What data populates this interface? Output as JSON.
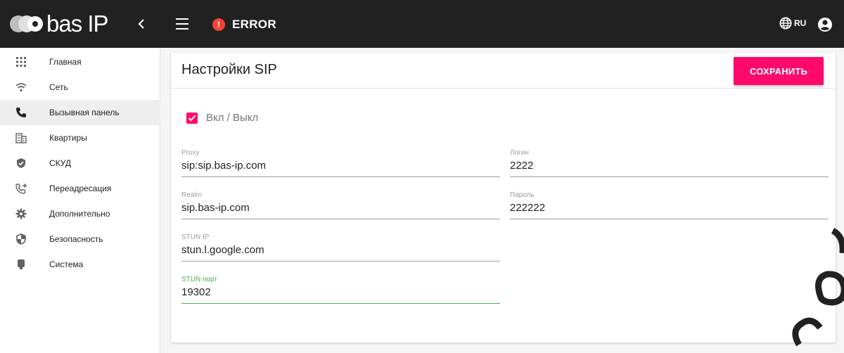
{
  "brand": {
    "name": "bas IP"
  },
  "topbar": {
    "status": "ERROR",
    "lang": "RU"
  },
  "sidebar": {
    "items": [
      {
        "label": "Главная",
        "icon": "grid-icon"
      },
      {
        "label": "Сеть",
        "icon": "wifi-icon"
      },
      {
        "label": "Вызывная панель",
        "icon": "phone-icon",
        "active": true
      },
      {
        "label": "Квартиры",
        "icon": "building-icon"
      },
      {
        "label": "СКУД",
        "icon": "shield-check-icon"
      },
      {
        "label": "Переадресация",
        "icon": "call-forward-icon"
      },
      {
        "label": "Дополнительно",
        "icon": "gear-icon"
      },
      {
        "label": "Безопасность",
        "icon": "security-icon"
      },
      {
        "label": "Система",
        "icon": "system-icon"
      }
    ]
  },
  "main": {
    "title": "Настройки SIP",
    "save_label": "СОХРАНИТЬ",
    "enable_label": "Вкл / Выкл",
    "fields": {
      "proxy": {
        "label": "Proxy",
        "value": "sip:sip.bas-ip.com"
      },
      "login": {
        "label": "Логин",
        "value": "2222"
      },
      "realm": {
        "label": "Realm",
        "value": "sip.bas-ip.com"
      },
      "password": {
        "label": "Пароль",
        "value": "222222"
      },
      "stun_ip": {
        "label": "STUN IP",
        "value": "stun.l.google.com"
      },
      "stun_port": {
        "label": "STUN порт",
        "value": "19302"
      }
    }
  },
  "colors": {
    "accent": "#ff0a6c",
    "topbar": "#212121",
    "error": "#f44336",
    "focus": "#4caf50"
  }
}
